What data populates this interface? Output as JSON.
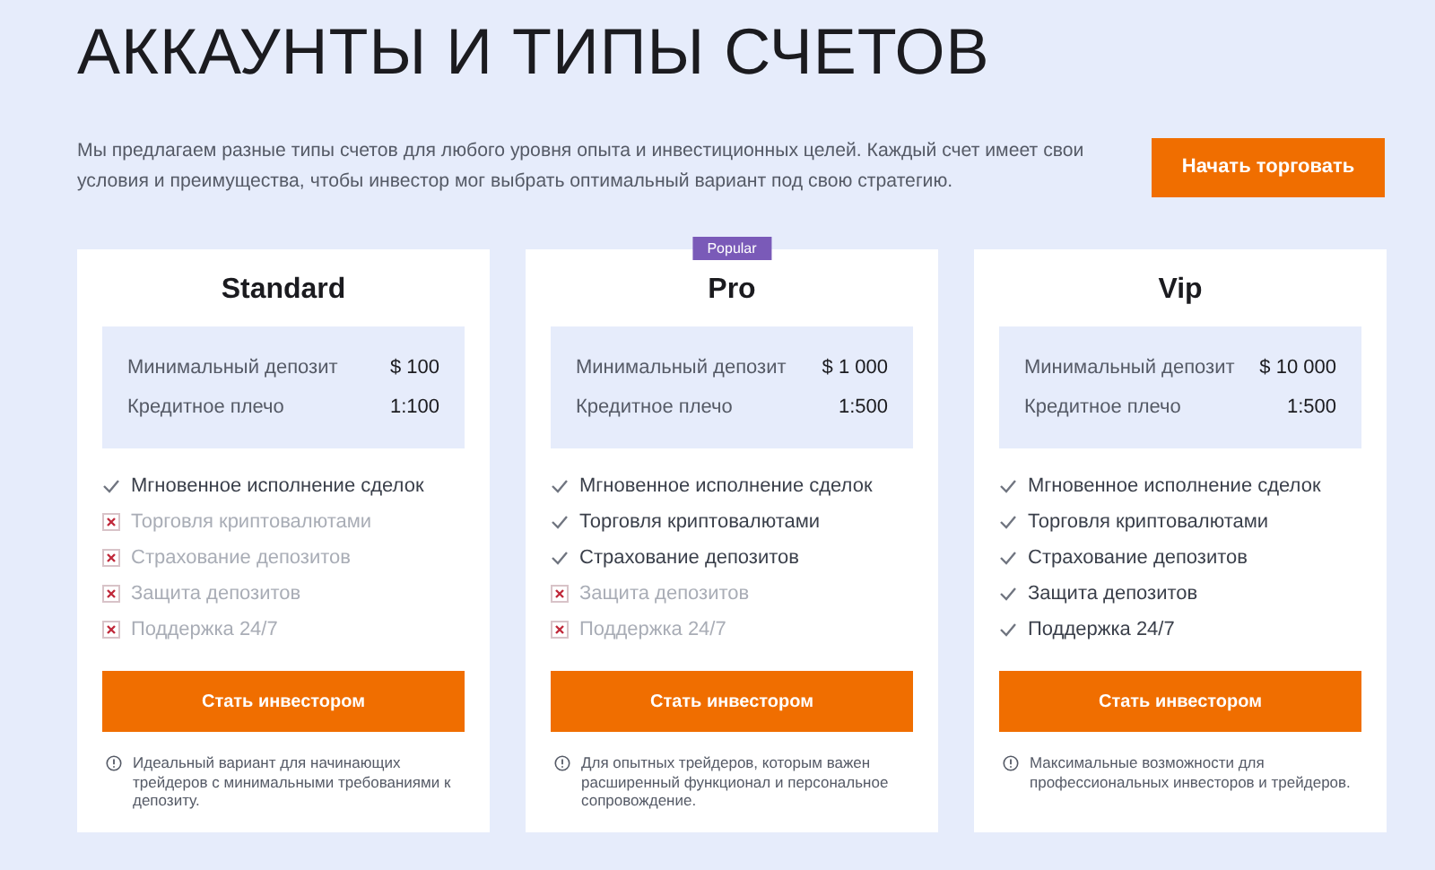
{
  "title": "АККАУНТЫ И ТИПЫ СЧЕТОВ",
  "intro": "Мы предлагаем разные типы счетов для любого уровня опыта и инвестиционных целей. Каждый счет имеет свои условия и преимущества, чтобы инвестор мог выбрать оптимальный вариант под свою стратегию.",
  "cta": "Начать торговать",
  "plans": [
    {
      "name": "Standard",
      "terms": [
        {
          "label": "Минимальный депозит",
          "value": "$ 100"
        },
        {
          "label": "Кредитное плечо",
          "value": "1:100"
        }
      ],
      "features": [
        {
          "label": "Мгновенное исполнение сделок",
          "included": true
        },
        {
          "label": "Торговля криптовалютами",
          "included": false
        },
        {
          "label": "Страхование депозитов",
          "included": false
        },
        {
          "label": "Защита депозитов",
          "included": false
        },
        {
          "label": "Поддержка 24/7",
          "included": false
        }
      ],
      "button": "Стать инвестором",
      "note": "Идеальный вариант для начинающих трейдеров с минимальными требованиями к депозиту."
    },
    {
      "name": "Pro",
      "badge": "Popular",
      "terms": [
        {
          "label": "Минимальный депозит",
          "value": "$ 1 000"
        },
        {
          "label": "Кредитное плечо",
          "value": "1:500"
        }
      ],
      "features": [
        {
          "label": "Мгновенное исполнение сделок",
          "included": true
        },
        {
          "label": "Торговля криптовалютами",
          "included": true
        },
        {
          "label": "Страхование депозитов",
          "included": true
        },
        {
          "label": "Защита депозитов",
          "included": false
        },
        {
          "label": "Поддержка 24/7",
          "included": false
        }
      ],
      "button": "Стать инвестором",
      "note": "Для опытных трейдеров, которым важен расширенный функционал и персональное сопровождение."
    },
    {
      "name": "Vip",
      "terms": [
        {
          "label": "Минимальный депозит",
          "value": "$ 10 000"
        },
        {
          "label": "Кредитное плечо",
          "value": "1:500"
        }
      ],
      "features": [
        {
          "label": "Мгновенное исполнение сделок",
          "included": true
        },
        {
          "label": "Торговля криптовалютами",
          "included": true
        },
        {
          "label": "Страхование депозитов",
          "included": true
        },
        {
          "label": "Защита депозитов",
          "included": true
        },
        {
          "label": "Поддержка 24/7",
          "included": true
        }
      ],
      "button": "Стать инвестором",
      "note": "Максимальные возможности для профессиональных инвесторов и трейдеров."
    }
  ]
}
